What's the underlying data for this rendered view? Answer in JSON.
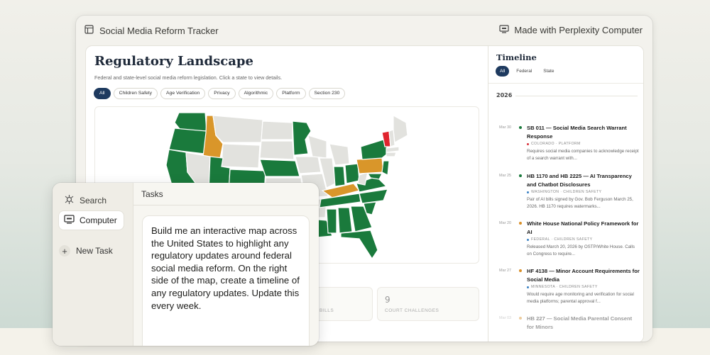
{
  "app": {
    "title": "Social Media Reform Tracker",
    "made_with": "Made with Perplexity Computer"
  },
  "main": {
    "heading": "Regulatory Landscape",
    "subtitle": "Federal and state-level social media reform legislation. Click a state to view details.",
    "filters": [
      "All",
      "Children Safety",
      "Age Verification",
      "Privacy",
      "Algorithmic",
      "Platform",
      "Section 230"
    ],
    "active_filter": "All",
    "stats": [
      {
        "value": "",
        "label": "BILLS"
      },
      {
        "value": "9",
        "label": "COURT CHALLENGES"
      }
    ]
  },
  "timeline": {
    "heading": "Timeline",
    "tabs": [
      "All",
      "Federal",
      "State"
    ],
    "active_tab": "All",
    "year": "2026",
    "entries": [
      {
        "date": "Mar 30",
        "dot": "#1a7a3c",
        "title": "SB 011 — Social Media Search Warrant Response",
        "meta": "COLORADO · PLATFORM",
        "meta_color": "#d8323c",
        "desc": "Requires social media companies to acknowledge receipt of a search warrant with..."
      },
      {
        "date": "Mar 25",
        "dot": "#1a7a3c",
        "title": "HB 1170 and HB 2225 — AI Transparency and Chatbot Disclosures",
        "meta": "WASHINGTON · CHILDREN SAFETY",
        "meta_color": "#3b82c4",
        "desc": "Pair of AI bills signed by Gov. Bob Ferguson March 25, 2026. HB 1170 requires watermarks..."
      },
      {
        "date": "Mar 20",
        "dot": "#d9902a",
        "title": "White House National Policy Framework for AI",
        "meta": "FEDERAL · CHILDREN SAFETY",
        "meta_color": "#3b82c4",
        "desc": "Released March 20, 2026 by OSTP/White House. Calls on Congress to require..."
      },
      {
        "date": "Mar 27",
        "dot": "#d9902a",
        "title": "HF 4138 — Minor Account Requirements for Social Media",
        "meta": "MINNESOTA · CHILDREN SAFETY",
        "meta_color": "#3b82c4",
        "desc": "Would require age monitoring and verification for social media platforms; parental approval f..."
      },
      {
        "date": "Mar 03",
        "dot": "#d9902a",
        "title": "HB 227 — Social Media Parental Consent for Minors",
        "meta": "",
        "meta_color": "#3b82c4",
        "desc": ""
      }
    ]
  },
  "task_window": {
    "nav": [
      {
        "label": "Search",
        "icon": "search-nav-icon",
        "active": false
      },
      {
        "label": "Computer",
        "icon": "computer-icon",
        "active": true
      }
    ],
    "new_task": "New Task",
    "header": "Tasks",
    "prompt": "Build me an interactive map across the United States to highlight any regulatory updates around federal social media reform. On the right side of the map, create a timeline of any regulatory updates. Update this every week."
  },
  "colors": {
    "enacted": "#1a7a3c",
    "pending": "#d9962a",
    "failed": "#e0242e",
    "none": "#e2e2de",
    "accent": "#1e3a5f"
  }
}
